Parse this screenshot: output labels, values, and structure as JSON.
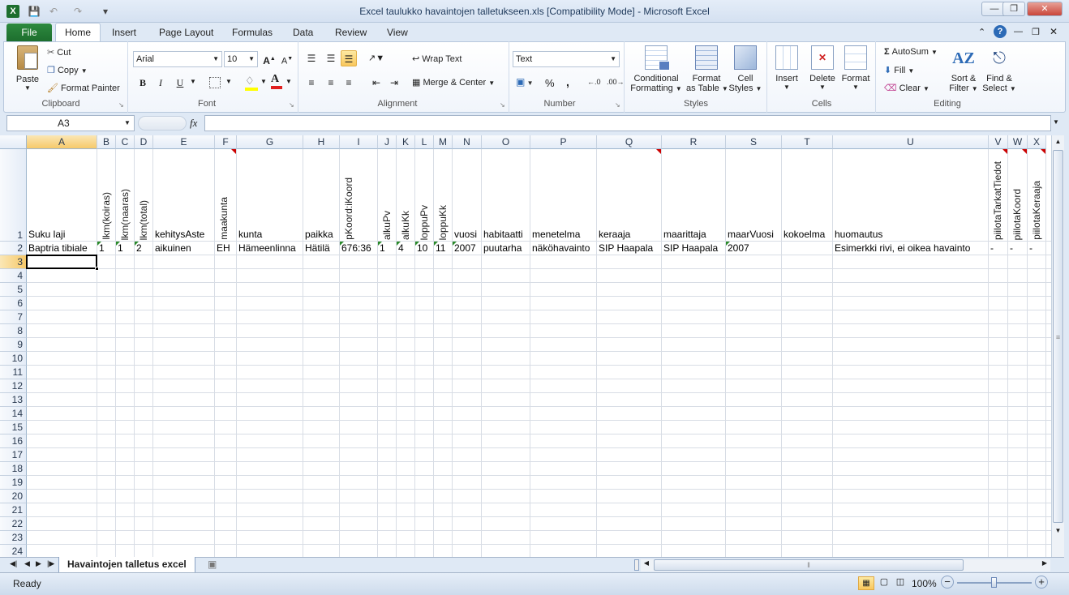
{
  "window": {
    "title": "Excel taulukko havaintojen talletukseen.xls  [Compatibility Mode]  -  Microsoft Excel"
  },
  "tabs": [
    {
      "label": "File"
    },
    {
      "label": "Home"
    },
    {
      "label": "Insert"
    },
    {
      "label": "Page Layout"
    },
    {
      "label": "Formulas"
    },
    {
      "label": "Data"
    },
    {
      "label": "Review"
    },
    {
      "label": "View"
    }
  ],
  "ribbon": {
    "clipboard": {
      "paste": "Paste",
      "cut": "Cut",
      "copy": "Copy",
      "format_painter": "Format Painter",
      "label": "Clipboard"
    },
    "font": {
      "name": "Arial",
      "size": "10",
      "label": "Font",
      "bold": "B",
      "italic": "I",
      "underline": "U"
    },
    "alignment": {
      "wrap_text": "Wrap Text",
      "merge_center": "Merge & Center",
      "label": "Alignment"
    },
    "number": {
      "format": "Text",
      "label": "Number",
      "percent": "%",
      "comma": ","
    },
    "styles": {
      "conditional": "Conditional",
      "formatting": "Formatting",
      "format_as": "Format",
      "as_table": "as Table",
      "cell": "Cell",
      "cell_styles": "Styles",
      "label": "Styles"
    },
    "cells": {
      "insert": "Insert",
      "delete": "Delete",
      "format": "Format",
      "label": "Cells"
    },
    "editing": {
      "autosum": "AutoSum",
      "fill": "Fill",
      "clear": "Clear",
      "sort": "Sort &",
      "filter": "Filter",
      "find": "Find &",
      "select": "Select",
      "label": "Editing"
    }
  },
  "formula_bar": {
    "name_box": "A3",
    "fx": "fx",
    "value": ""
  },
  "columns": [
    "A",
    "B",
    "C",
    "D",
    "E",
    "F",
    "G",
    "H",
    "I",
    "J",
    "K",
    "L",
    "M",
    "N",
    "O",
    "P",
    "Q",
    "R",
    "S",
    "T",
    "U",
    "V",
    "W",
    "X"
  ],
  "header_row": [
    "Suku laji",
    "lkm(koiras)",
    "lkm(naaras)",
    "lkm(total)",
    "kehitysAste",
    "maakunta",
    "kunta",
    "paikka",
    "pKoord:iKoord",
    "alkuPv",
    "alkuKk",
    "loppuPv",
    "loppuKk",
    "vuosi",
    "habitaatti",
    "menetelma",
    "keraaja",
    "maarittaja",
    "maarVuosi",
    "kokoelma",
    "huomautus",
    "piilotaTarkatTiedot",
    "piilotaKoord",
    "piilotaKeraaja"
  ],
  "data_row": [
    "Baptria tibiale",
    "1",
    "1",
    "2",
    "aikuinen",
    "EH",
    "Hämeenlinna",
    "Hätilä",
    "676:36",
    "1",
    "4",
    "10",
    "11",
    "2007",
    "puutarha",
    "näköhavainto",
    "SIP Haapala",
    "SIP Haapala",
    "2007",
    "",
    "Esimerkki rivi, ei oikea havainto",
    "-",
    "-",
    "-"
  ],
  "row_numbers": [
    "1",
    "2",
    "3",
    "4",
    "5",
    "6",
    "7",
    "8",
    "9",
    "10",
    "11",
    "12",
    "13",
    "14",
    "15",
    "16",
    "17",
    "18",
    "19",
    "20",
    "21",
    "22",
    "23",
    "24"
  ],
  "sheet_tab": "Havaintojen talletus excel",
  "status": {
    "ready": "Ready",
    "zoom": "100%"
  },
  "colors": {
    "selection": "#000000",
    "comment_marker": "#cc0000",
    "error_marker": "#2a8a2a",
    "file_tab": "#1d6e2e"
  }
}
